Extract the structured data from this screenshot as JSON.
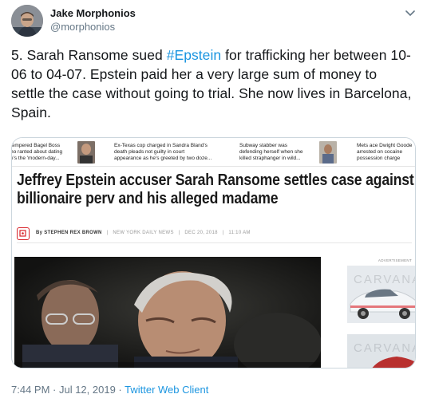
{
  "author": {
    "name": "Jake Morphonios",
    "handle": "@morphonios",
    "avatar_icon": "user-avatar"
  },
  "tweet": {
    "text_before": "5. Sarah Ransome sued ",
    "hashtag": "#Epstein",
    "text_after": " for trafficking her between 10-06 to 04-07.  Epstein paid her a very large sum of money to settle the case without going to trial. She now lives in Barcelona, Spain.",
    "hashtag_color": "#1b95e0"
  },
  "article": {
    "strip": [
      {
        "text": "tempered Bagel Boss\nho ranted about dating\ne's the 'modern-day..."
      },
      {
        "text": "Ex-Texas cop charged in Sandra Bland's\ndeath pleads not guilty in court\nappearance as he's greeted by two doze..."
      },
      {
        "text": "Subway stabber was\ndefending herself when she\nkilled straphanger in wild..."
      },
      {
        "text": "Mets ace Dwight Goode\narrested on cocaine\npossession charge"
      }
    ],
    "headline": "Jeffrey Epstein accuser Sarah Ransome settles case against billionaire perv and his alleged madame",
    "byline": "By STEPHEN REX BROWN",
    "publication": "NEW YORK DAILY NEWS",
    "date": "DEC 20, 2018",
    "time": "11:10 AM",
    "ad_label": "ADVERTISEMENT",
    "ad_brand": "CARVANA",
    "brand_color": "#d8232a"
  },
  "footer": {
    "timestamp": "7:44 PM · Jul 12, 2019 · ",
    "client": "Twitter Web Client"
  }
}
